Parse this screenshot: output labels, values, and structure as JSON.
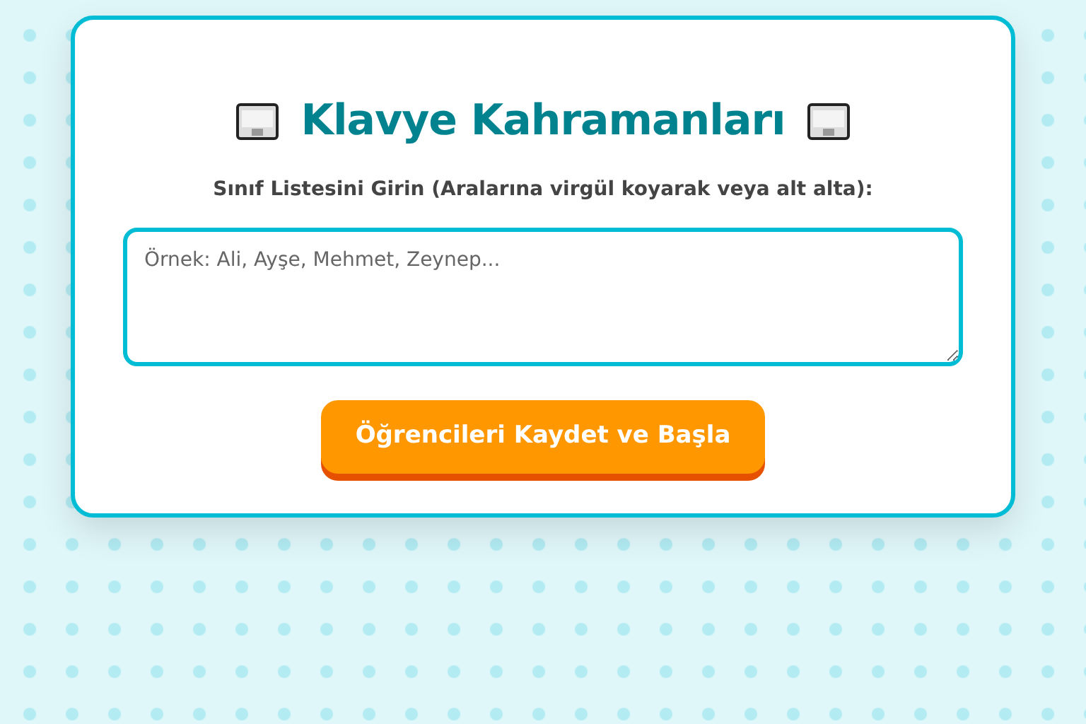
{
  "title": "Klavye Kahramanları",
  "label": "Sınıf Listesini Girin (Aralarına virgül koyarak veya alt alta):",
  "student_list": {
    "placeholder": "Örnek: Ali, Ayşe, Mehmet, Zeynep..."
  },
  "button": "Öğrencileri Kaydet ve Başla"
}
